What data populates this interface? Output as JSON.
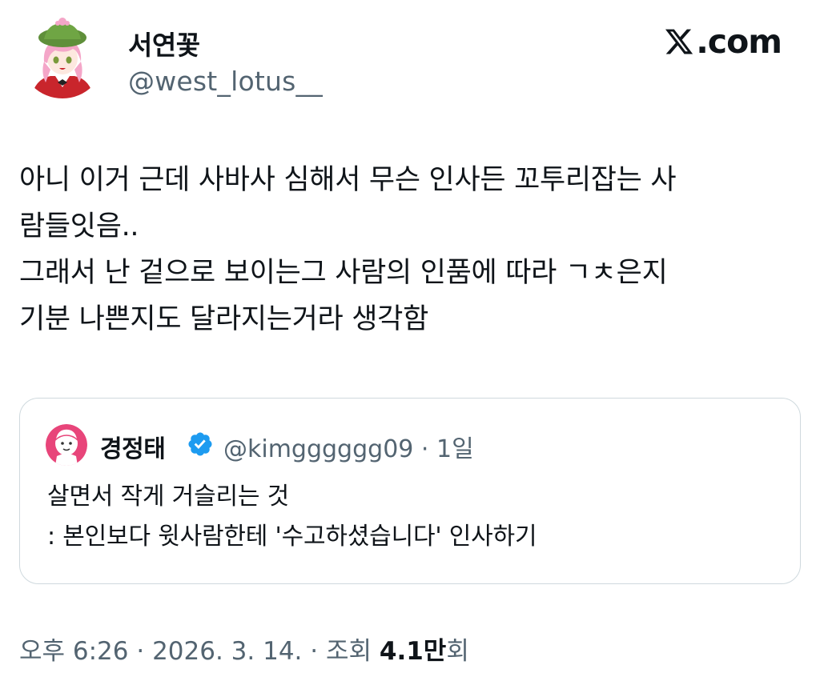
{
  "author": {
    "display_name": "서연꽃",
    "handle": "@west_lotus__"
  },
  "site": {
    "logo_text": ".com"
  },
  "tweet": {
    "text": "아니 이거 근데 사바사 심해서 무슨 인사든 꼬투리잡는 사\n람들잇음..\n그래서 난 겉으로 보이는그 사람의 인품에 따라 ㄱㅊ은지\n기분 나쁜지도 달라지는거라 생각함"
  },
  "quote": {
    "display_name": "경정태",
    "handle": "@kimgggggg09",
    "separator": " · ",
    "time": "1일",
    "text": "살면서 작게 거슬리는 것\n: 본인보다 윗사람한테 '수고하셨습니다' 인사하기"
  },
  "meta": {
    "time": "오후 6:26",
    "separator": " · ",
    "date": "2026. 3. 14.",
    "views_label": "조회 ",
    "views_count": "4.1만",
    "views_suffix": "회"
  },
  "colors": {
    "text": "#0f1419",
    "secondary": "#536471",
    "border": "#cfd9de",
    "verified": "#1d9bf0"
  },
  "icons": {
    "verified": "verified-badge-icon",
    "x_logo": "x-logo-icon"
  }
}
